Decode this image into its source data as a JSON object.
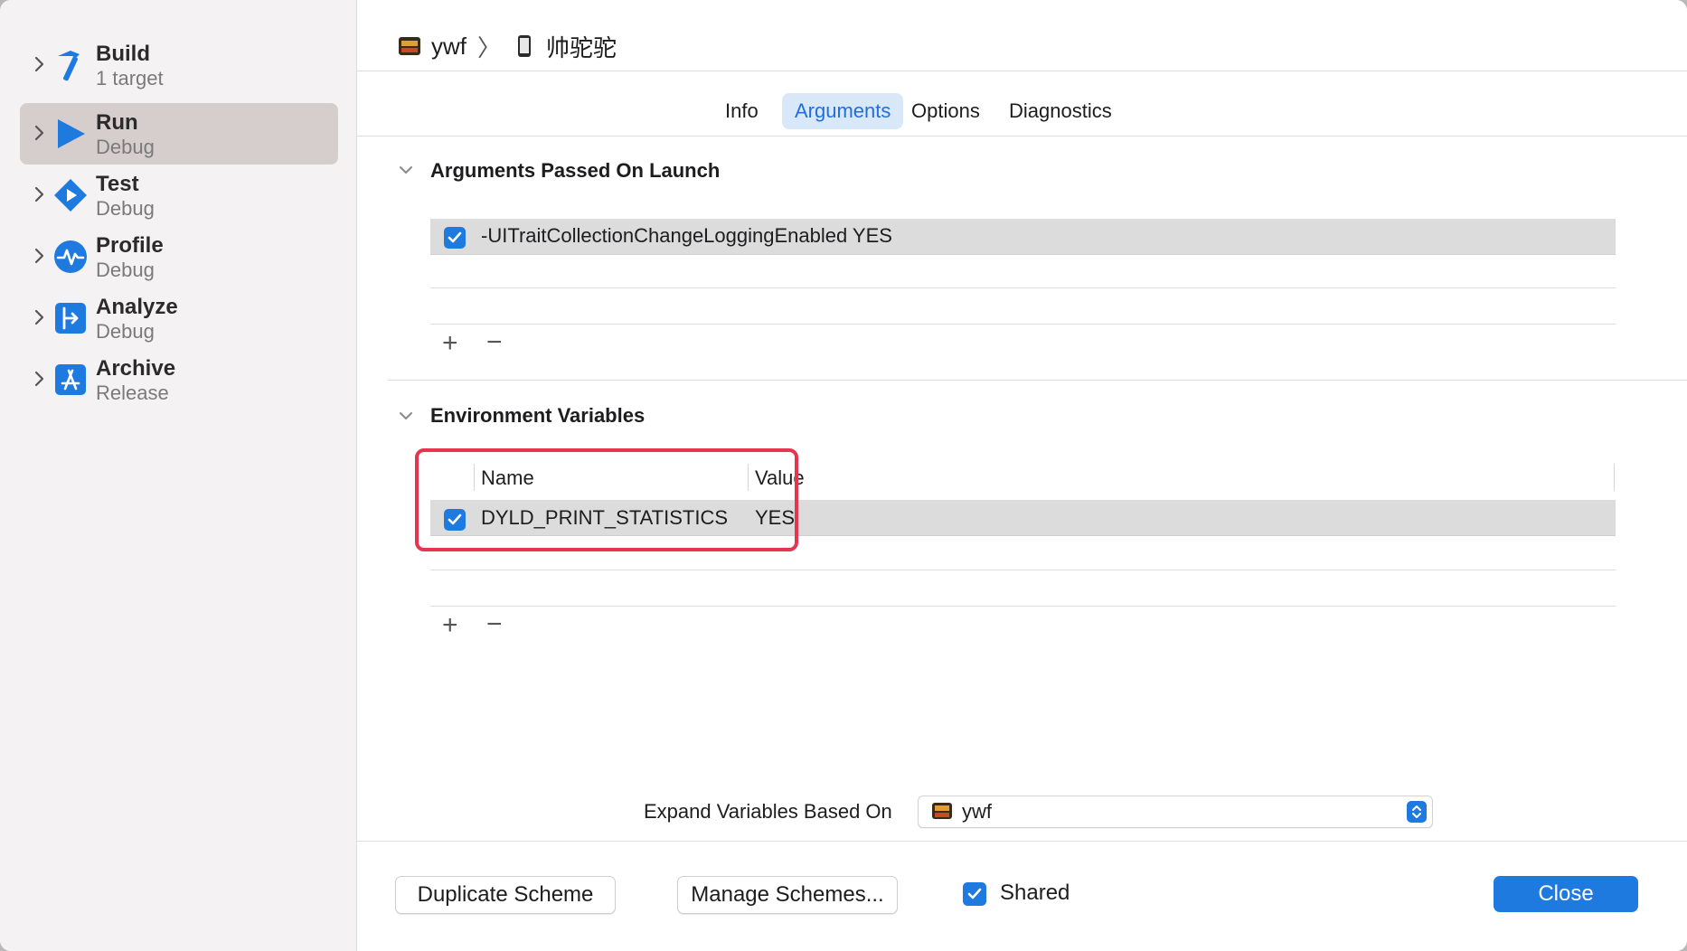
{
  "sidebar": {
    "items": [
      {
        "title": "Build",
        "subtitle": "1 target",
        "icon": "hammer-icon",
        "selected": false
      },
      {
        "title": "Run",
        "subtitle": "Debug",
        "icon": "play-icon",
        "selected": true
      },
      {
        "title": "Test",
        "subtitle": "Debug",
        "icon": "test-diamond-icon",
        "selected": false
      },
      {
        "title": "Profile",
        "subtitle": "Debug",
        "icon": "waveform-icon",
        "selected": false
      },
      {
        "title": "Analyze",
        "subtitle": "Debug",
        "icon": "analyze-icon",
        "selected": false
      },
      {
        "title": "Archive",
        "subtitle": "Release",
        "icon": "appstore-icon",
        "selected": false
      }
    ]
  },
  "breadcrumb": {
    "scheme": "ywf",
    "device": "帅驼驼",
    "scheme_icon": "app-icon",
    "device_icon": "iphone-icon"
  },
  "tabs": [
    {
      "label": "Info",
      "active": false
    },
    {
      "label": "Arguments",
      "active": true
    },
    {
      "label": "Options",
      "active": false
    },
    {
      "label": "Diagnostics",
      "active": false
    }
  ],
  "arguments": {
    "title": "Arguments Passed On Launch",
    "rows": [
      {
        "checked": true,
        "value": "-UITraitCollectionChangeLoggingEnabled YES"
      }
    ]
  },
  "environment": {
    "title": "Environment Variables",
    "columns": {
      "name": "Name",
      "value": "Value"
    },
    "rows": [
      {
        "checked": true,
        "name": "DYLD_PRINT_STATISTICS",
        "value": "YES"
      }
    ]
  },
  "expand": {
    "label": "Expand Variables Based On",
    "selected": "ywf"
  },
  "footer": {
    "duplicate_label": "Duplicate Scheme",
    "manage_label": "Manage Schemes...",
    "shared_label": "Shared",
    "shared_checked": true,
    "close_label": "Close"
  },
  "colors": {
    "accent": "#1f7ae0",
    "highlight_border": "#e8354f",
    "selected_sidebar": "#d6cdcd"
  }
}
